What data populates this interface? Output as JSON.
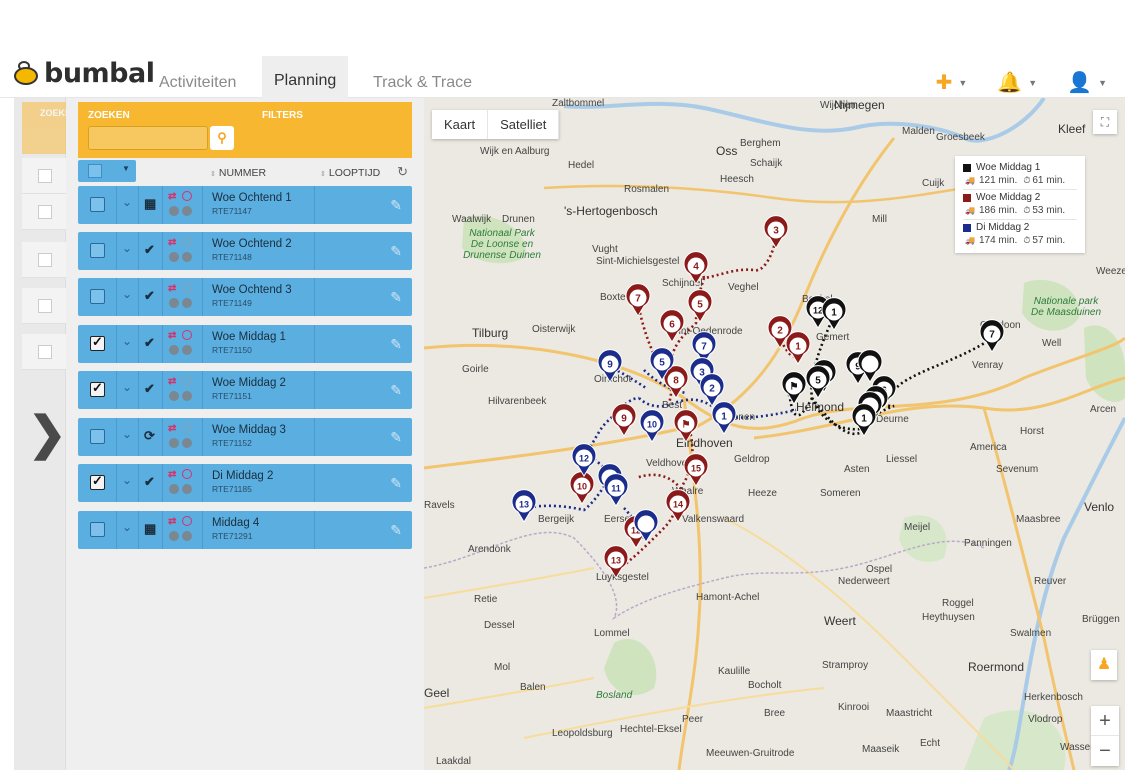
{
  "app": {
    "logo": "bumbal"
  },
  "nav": {
    "tabs": [
      "Activiteiten",
      "Planning",
      "Track & Trace"
    ],
    "active": "Planning"
  },
  "search": {
    "label": "ZOEKEN",
    "filters_label": "FILTERS",
    "ghost_label": "ZOEKE",
    "value": ""
  },
  "table": {
    "col_number": "NUMMER",
    "col_duration": "LOOPTIJD"
  },
  "routes": [
    {
      "name": "Woe Ochtend 1",
      "number": "RTE71147",
      "checked": false,
      "state": "calendar"
    },
    {
      "name": "Woe Ochtend 2",
      "number": "RTE71148",
      "checked": false,
      "state": "check"
    },
    {
      "name": "Woe Ochtend 3",
      "number": "RTE71149",
      "checked": false,
      "state": "check"
    },
    {
      "name": "Woe Middag 1",
      "number": "RTE71150",
      "checked": true,
      "state": "check"
    },
    {
      "name": "Woe Middag 2",
      "number": "RTE71151",
      "checked": true,
      "state": "check"
    },
    {
      "name": "Woe Middag 3",
      "number": "RTE71152",
      "checked": false,
      "state": "sync"
    },
    {
      "name": "Di Middag 2",
      "number": "RTE71185",
      "checked": true,
      "state": "check"
    },
    {
      "name": "Middag 4",
      "number": "RTE71291",
      "checked": false,
      "state": "calendar"
    }
  ],
  "map": {
    "tabs": [
      "Kaart",
      "Satelliet"
    ],
    "legend": [
      {
        "name": "Woe Middag 1",
        "color": "#111111",
        "drive": "121 min.",
        "time": "61 min."
      },
      {
        "name": "Woe Middag 2",
        "color": "#8b1a1a",
        "drive": "186 min.",
        "time": "53 min."
      },
      {
        "name": "Di Middag 2",
        "color": "#1c2c8a",
        "drive": "174 min.",
        "time": "57 min."
      }
    ],
    "places": [
      "Nijmegen",
      "Oss",
      "Kleef",
      "Malden",
      "Groesbeek",
      "Wijchen",
      "Zaltbommel",
      "Berghem",
      "Waalwijk",
      "Drunen",
      "'s-Hertogenbosch",
      "Rosmalen",
      "Heesch",
      "Schaijk",
      "Cuijk",
      "Vught",
      "Sint-Michielsgestel",
      "Schijndel",
      "Veghel",
      "Boxtel",
      "Tilburg",
      "Oisterwijk",
      "Goirle",
      "Hilvarenbeek",
      "Eindhoven",
      "Veldhoven",
      "Geldrop",
      "Helmond",
      "Deurne",
      "Venray",
      "Overloon",
      "Boekel",
      "Gemert",
      "Heeze",
      "Asten",
      "Someren",
      "Liessel",
      "America",
      "Horst",
      "Sevenum",
      "Arcen",
      "Venlo",
      "Maasbree",
      "Meijel",
      "Panningen",
      "Reuver",
      "Ospel",
      "Nederweert",
      "Weert",
      "Roggel",
      "Heythuysen",
      "Swalmen",
      "Roermond",
      "Stramproy",
      "Kinrooi",
      "Maastricht",
      "Herkenbosch",
      "Vlodrop",
      "Echt",
      "Maaseik",
      "Wassen",
      "Bocholt",
      "Kaulille",
      "Bree",
      "Peer",
      "Hechtel-Eksel",
      "Leopoldsburg",
      "Meeuwen-Gruitrode",
      "Lommel",
      "Hamont-Achel",
      "Dessel",
      "Retie",
      "Mol",
      "Balen",
      "Geel",
      "Arendonk",
      "Ravels",
      "Valkenswaard",
      "Waalre",
      "Eersel",
      "Luyksgestel",
      "Bergeijk",
      "Oirschot",
      "Best",
      "Sint-Oedenrode",
      "Nuenen",
      "Laakdal",
      "Brüggen",
      "Well",
      "Weeze",
      "Hedel",
      "Wijk en Aalburg",
      "Mill",
      "Bosland",
      "Nationaal Park De Loonse en Drunense Duinen",
      "Nationale park De Maasduinen"
    ]
  }
}
